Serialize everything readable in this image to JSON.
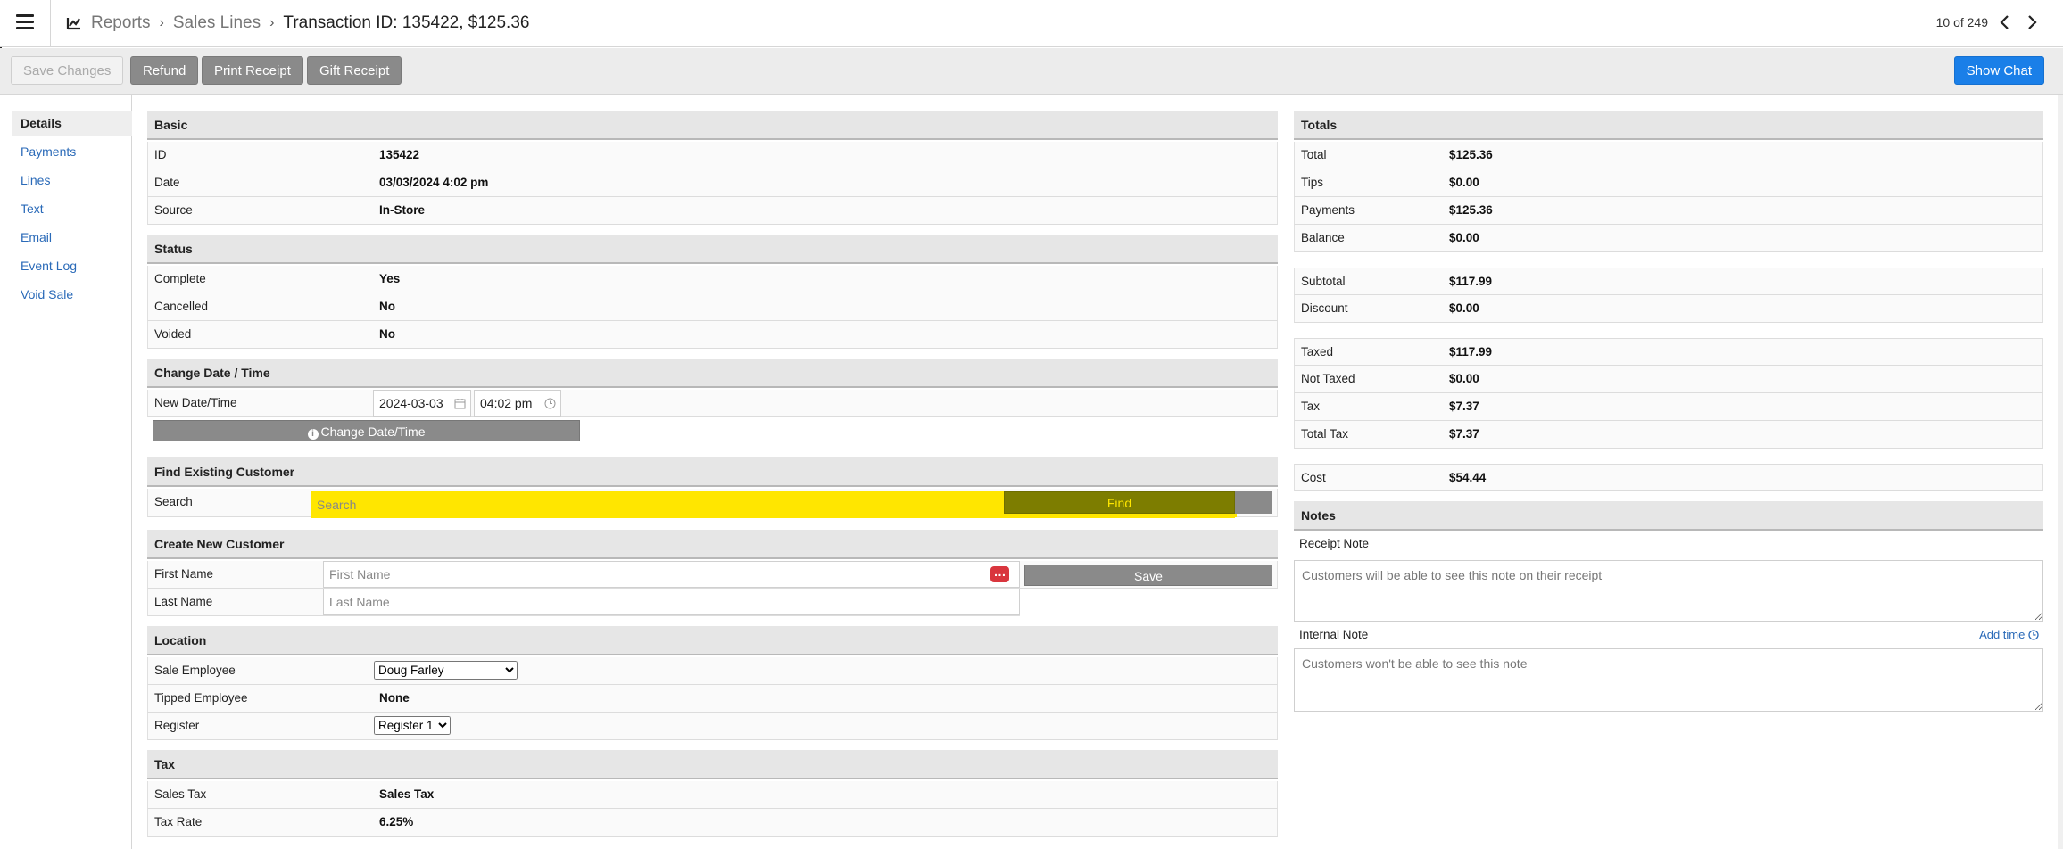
{
  "breadcrumb": {
    "items": [
      "Reports",
      "Sales Lines"
    ],
    "current": "Transaction ID: 135422, $125.36"
  },
  "pager": {
    "text": "10 of 249"
  },
  "toolbar": {
    "save": "Save Changes",
    "refund": "Refund",
    "print_receipt": "Print Receipt",
    "gift_receipt": "Gift Receipt",
    "show_chat": "Show Chat"
  },
  "nav": {
    "details": "Details",
    "payments": "Payments",
    "lines": "Lines",
    "text": "Text",
    "email": "Email",
    "event_log": "Event Log",
    "void_sale": "Void Sale"
  },
  "basic": {
    "title": "Basic",
    "id_label": "ID",
    "id_value": "135422",
    "date_label": "Date",
    "date_value": "03/03/2024 4:02 pm",
    "source_label": "Source",
    "source_value": "In-Store"
  },
  "status": {
    "title": "Status",
    "complete_label": "Complete",
    "complete_value": "Yes",
    "cancelled_label": "Cancelled",
    "cancelled_value": "No",
    "voided_label": "Voided",
    "voided_value": "No"
  },
  "change_date": {
    "title": "Change Date / Time",
    "label": "New Date/Time",
    "date_value": "2024-03-03",
    "time_value": "04:02 pm",
    "button": "Change Date/Time"
  },
  "find_customer": {
    "title": "Find Existing Customer",
    "label": "Search",
    "placeholder": "Search",
    "button": "Find"
  },
  "new_customer": {
    "title": "Create New Customer",
    "first_label": "First Name",
    "first_placeholder": "First Name",
    "last_label": "Last Name",
    "last_placeholder": "Last Name",
    "save": "Save"
  },
  "location": {
    "title": "Location",
    "employee_label": "Sale Employee",
    "employee_value": "Doug Farley",
    "tipped_label": "Tipped Employee",
    "tipped_value": "None",
    "register_label": "Register",
    "register_value": "Register 1"
  },
  "tax": {
    "title": "Tax",
    "sales_tax_label": "Sales Tax",
    "sales_tax_value": "Sales Tax",
    "rate_label": "Tax Rate",
    "rate_value": "6.25%"
  },
  "totals": {
    "title": "Totals",
    "total_label": "Total",
    "total_value": "$125.36",
    "tips_label": "Tips",
    "tips_value": "$0.00",
    "payments_label": "Payments",
    "payments_value": "$125.36",
    "balance_label": "Balance",
    "balance_value": "$0.00",
    "subtotal_label": "Subtotal",
    "subtotal_value": "$117.99",
    "discount_label": "Discount",
    "discount_value": "$0.00",
    "taxed_label": "Taxed",
    "taxed_value": "$117.99",
    "not_taxed_label": "Not Taxed",
    "not_taxed_value": "$0.00",
    "tax_label": "Tax",
    "tax_value": "$7.37",
    "total_tax_label": "Total Tax",
    "total_tax_value": "$7.37",
    "cost_label": "Cost",
    "cost_value": "$54.44"
  },
  "notes": {
    "title": "Notes",
    "receipt_label": "Receipt Note",
    "receipt_placeholder": "Customers will be able to see this note on their receipt",
    "internal_label": "Internal Note",
    "internal_placeholder": "Customers won't be able to see this note",
    "add_time": "Add time"
  },
  "colors": {
    "link": "#2a6ab8",
    "primary_button": "#1a7fe8",
    "grey_button": "#8a8a8a",
    "highlight": "#ffe600"
  },
  "icons": [
    "menu-icon",
    "chart-line-icon",
    "chevron-right-icon",
    "chevron-left-icon",
    "calendar-icon",
    "clock-icon",
    "info-icon",
    "more-icon"
  ]
}
